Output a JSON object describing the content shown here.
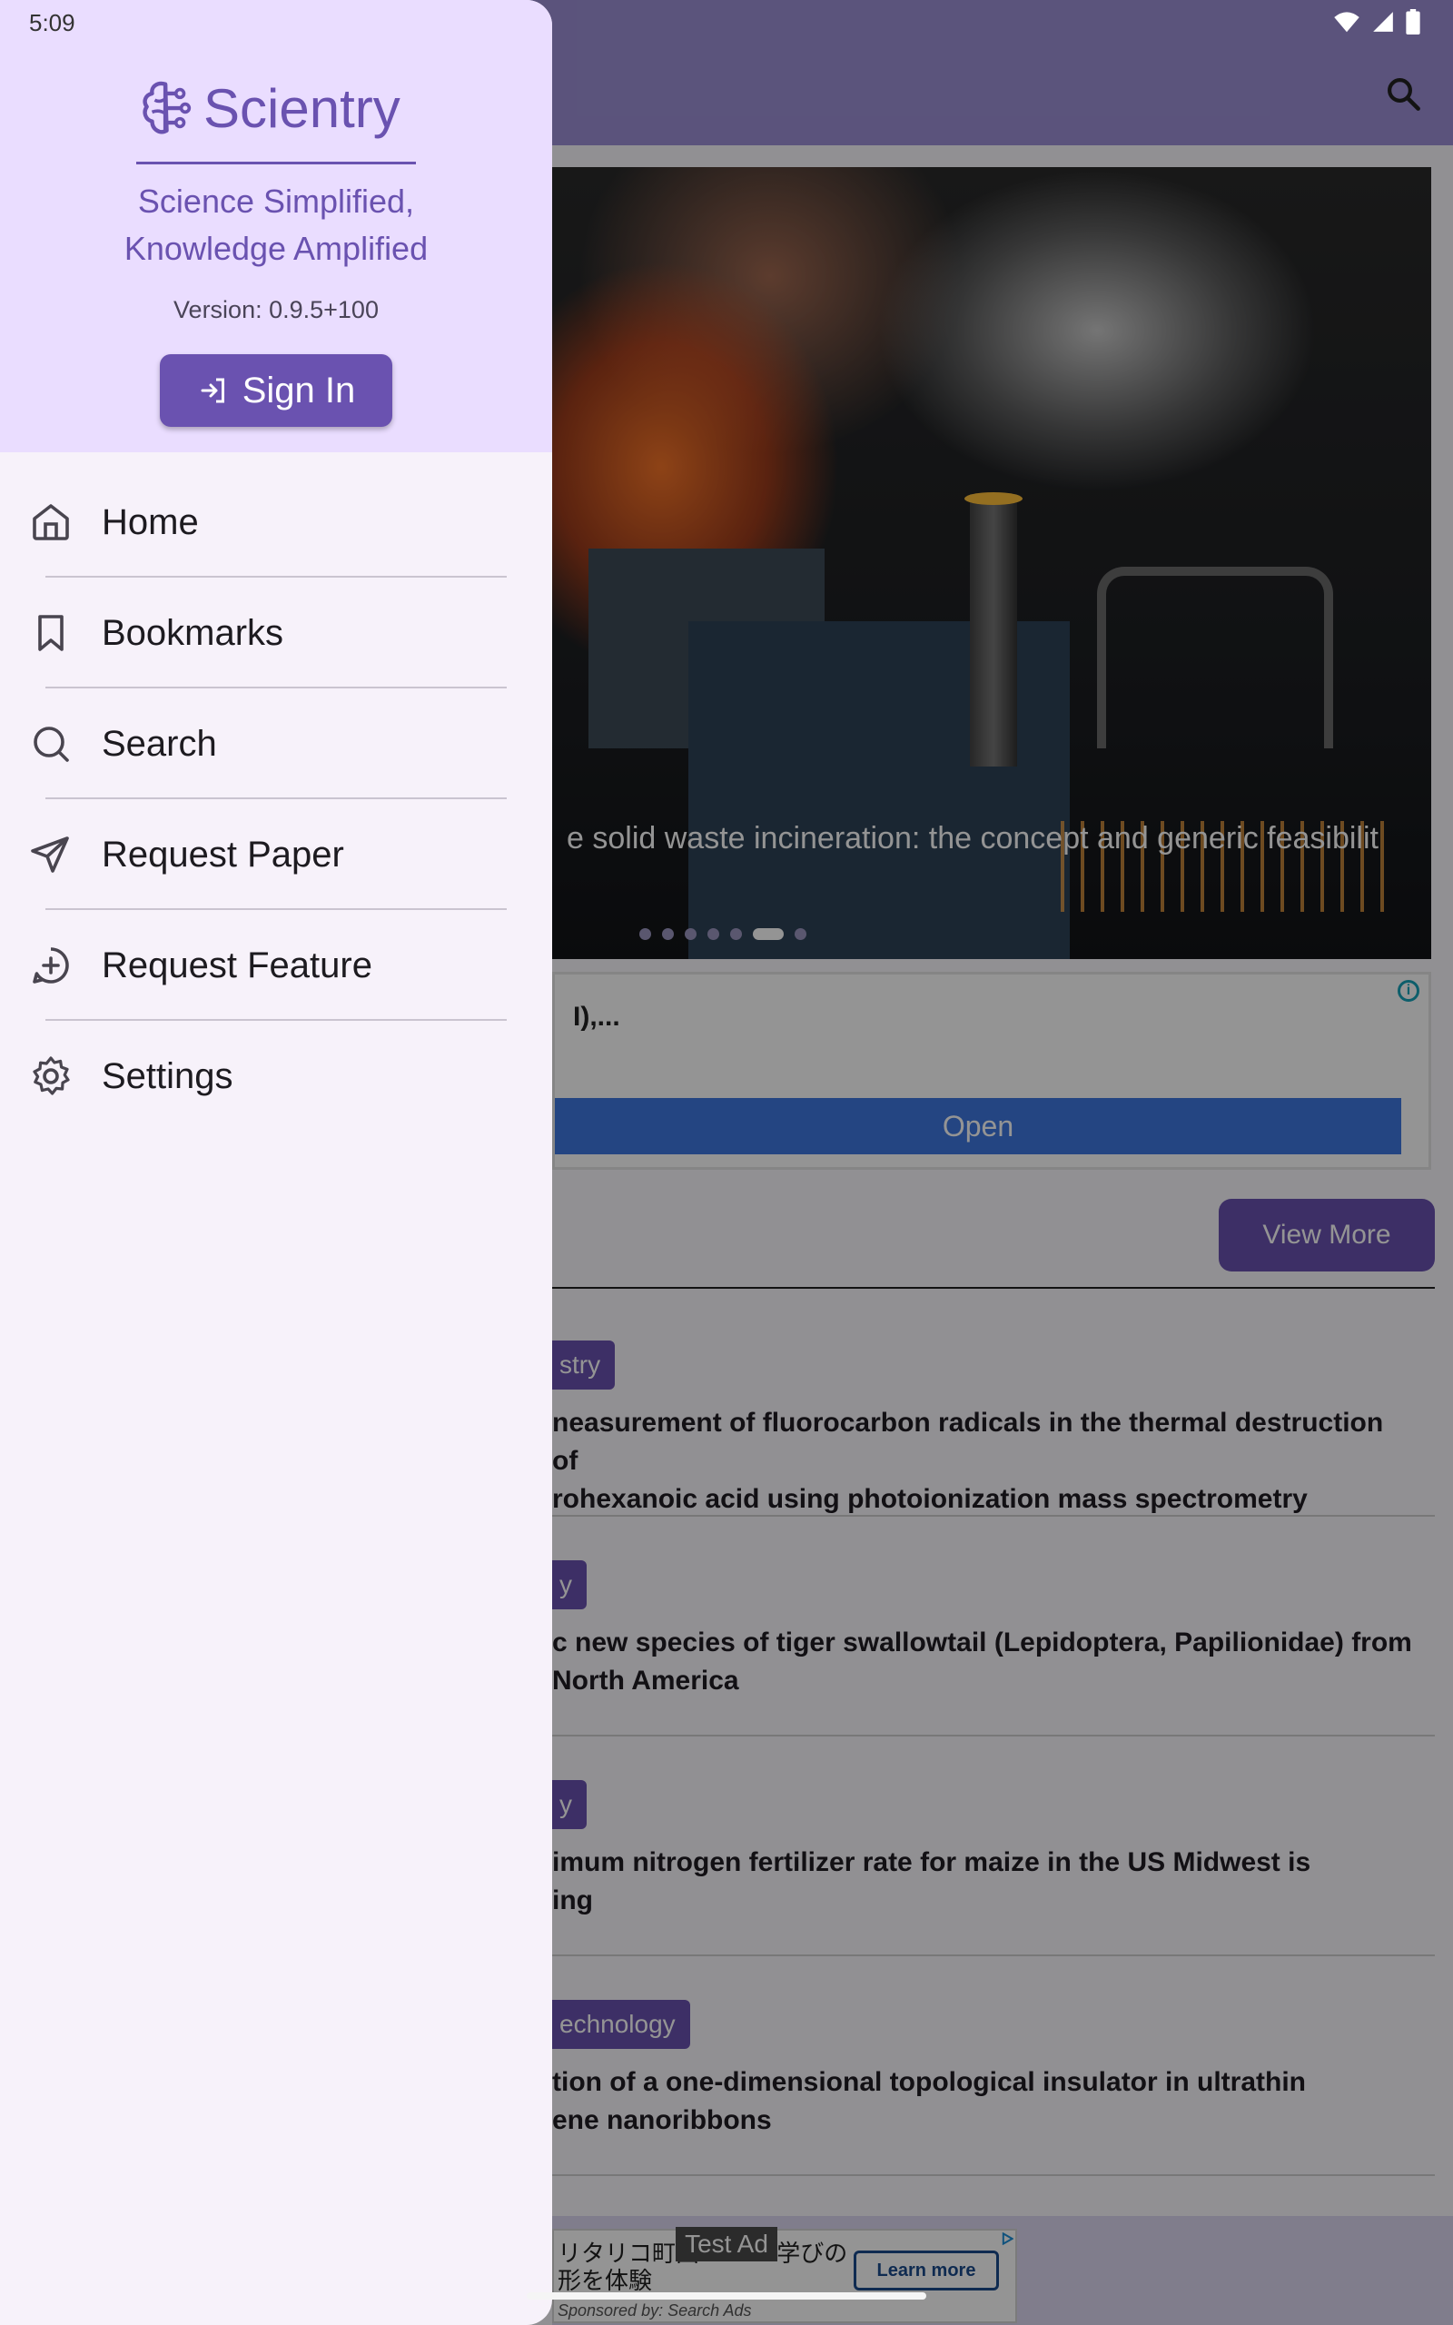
{
  "status_bar": {
    "time": "5:09"
  },
  "background": {
    "hero": {
      "caption": "e solid waste incineration: the concept and generic feasibilit",
      "dots": [
        false,
        false,
        false,
        false,
        false,
        true,
        false
      ]
    },
    "ad_card": {
      "text": "I),...",
      "open_label": "Open",
      "info_label": "i"
    },
    "view_more_label": "View More",
    "articles": [
      {
        "tag": "stry",
        "title_lines": [
          "neasurement of fluorocarbon radicals in the thermal destruction of",
          "rohexanoic acid using photoionization mass spectrometry"
        ]
      },
      {
        "tag": "y",
        "title_lines": [
          "c new species of tiger swallowtail (Lepidoptera, Papilionidae) from",
          " North America"
        ]
      },
      {
        "tag": "y",
        "title_lines": [
          "imum nitrogen fertilizer rate for maize in the US Midwest is",
          "ing"
        ]
      },
      {
        "tag": "echnology",
        "title_lines": [
          "tion of a one-dimensional topological insulator in ultrathin",
          "ene nanoribbons"
        ]
      }
    ],
    "bottom_ad": {
      "text_line1": "リタリコ町田",
      "text_line1b": "学びの",
      "text_line2": "形を体験",
      "learn_more": "Learn more",
      "sponsored": "Sponsored by: Search Ads",
      "test_ad": "Test Ad"
    }
  },
  "drawer": {
    "logo_text": "Scientry",
    "tagline_line1": "Science Simplified,",
    "tagline_line2": "Knowledge Amplified",
    "version": "Version: 0.9.5+100",
    "sign_in_label": "Sign In",
    "nav_items": [
      {
        "label": "Home",
        "icon": "home-icon"
      },
      {
        "label": "Bookmarks",
        "icon": "bookmark-icon"
      },
      {
        "label": "Search",
        "icon": "search-icon"
      },
      {
        "label": "Request Paper",
        "icon": "send-icon"
      },
      {
        "label": "Request Feature",
        "icon": "feature-request-icon"
      },
      {
        "label": "Settings",
        "icon": "settings-icon"
      }
    ]
  },
  "colors": {
    "brand": "#6a52b0",
    "drawer_header": "#eaddff",
    "drawer_bg": "#f7f2fa",
    "appbar": "#9d90d6"
  }
}
